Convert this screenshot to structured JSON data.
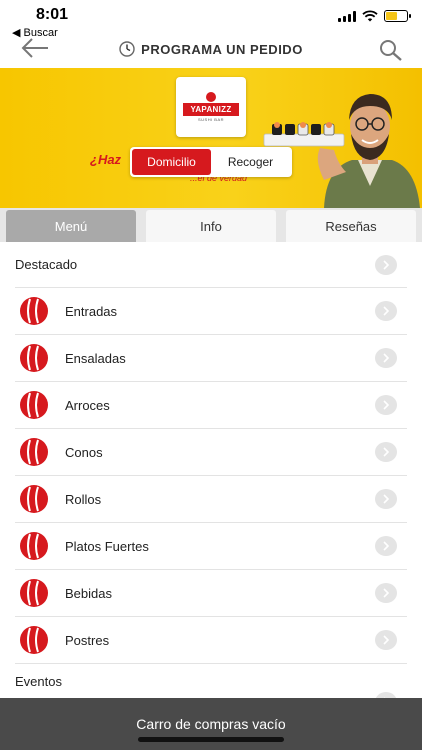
{
  "status_bar": {
    "time": "8:01",
    "back_label": "◀ Buscar"
  },
  "header": {
    "title": "PROGRAMA UN PEDIDO",
    "clock_icon": "clock-icon",
    "search_icon": "search-icon",
    "back_icon": "back-arrow-icon"
  },
  "hero": {
    "logo_text": "YAPANIZZ",
    "logo_subtext": "SUSHI BAR",
    "tagline": "¿Haz",
    "tagline_sub": "...el de verdad",
    "order_modes": [
      {
        "label": "Domicilio",
        "selected": true
      },
      {
        "label": "Recoger",
        "selected": false
      }
    ]
  },
  "tabs": [
    {
      "label": "Menú",
      "active": true
    },
    {
      "label": "Info",
      "active": false
    },
    {
      "label": "Reseñas",
      "active": false
    }
  ],
  "menu": {
    "featured_label": "Destacado",
    "categories": [
      {
        "label": "Entradas"
      },
      {
        "label": "Ensaladas"
      },
      {
        "label": "Arroces"
      },
      {
        "label": "Conos"
      },
      {
        "label": "Rollos"
      },
      {
        "label": "Platos Fuertes"
      },
      {
        "label": "Bebidas"
      },
      {
        "label": "Postres"
      }
    ],
    "events_label": "Eventos"
  },
  "cart": {
    "label": "Carro de compras vacío"
  },
  "colors": {
    "brand_red": "#d6191e",
    "hero_yellow": "#f7c600",
    "cart_bar": "#4a4a4a",
    "active_tab": "#a9a9a9"
  }
}
